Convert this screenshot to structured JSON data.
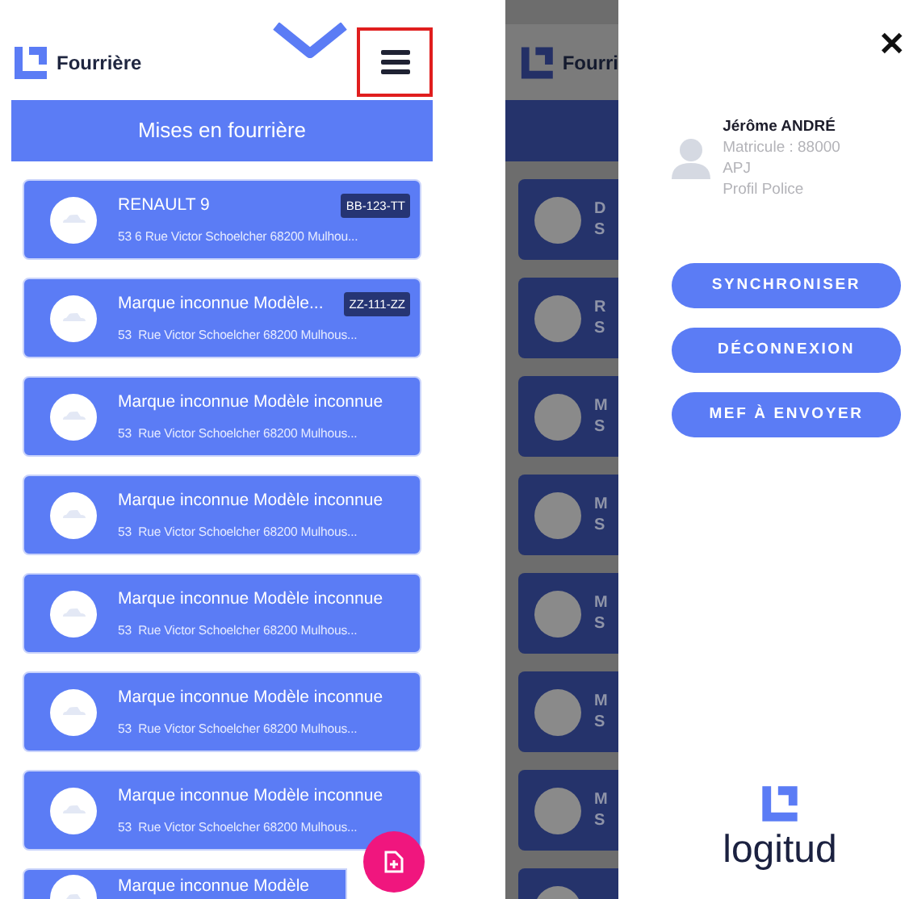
{
  "left_screen": {
    "app_name": "Fourrière",
    "menu_highlighted": true,
    "title": "Mises en fourrière",
    "vehicles": [
      {
        "title": "RENAULT 9",
        "plate": "BB-123-TT",
        "address": "53 6 Rue Victor Schoelcher 68200 Mulhou..."
      },
      {
        "title": "Marque inconnue Modèle...",
        "plate": "ZZ-111-ZZ",
        "address": "53  Rue Victor Schoelcher 68200 Mulhous..."
      },
      {
        "title": "Marque inconnue Modèle inconnue",
        "address": "53  Rue Victor Schoelcher 68200 Mulhous..."
      },
      {
        "title": "Marque inconnue Modèle inconnue",
        "address": "53  Rue Victor Schoelcher 68200 Mulhous..."
      },
      {
        "title": "Marque inconnue Modèle inconnue",
        "address": "53  Rue Victor Schoelcher 68200 Mulhous..."
      },
      {
        "title": "Marque inconnue Modèle inconnue",
        "address": "53  Rue Victor Schoelcher 68200 Mulhous..."
      },
      {
        "title": "Marque inconnue Modèle inconnue",
        "address": "53  Rue Victor Schoelcher 68200 Mulhous..."
      },
      {
        "title": "Marque inconnue Modèle"
      }
    ]
  },
  "right_screen": {
    "background": {
      "app_name": "Fourri",
      "cards": [
        {
          "kind": "text",
          "title": "D",
          "address": "S"
        },
        {
          "kind": "text",
          "title": "R",
          "address": "S"
        },
        {
          "kind": "text",
          "title": "M",
          "address": "S"
        },
        {
          "kind": "text",
          "title": "M",
          "address": "S"
        },
        {
          "kind": "text",
          "title": "M",
          "address": "S"
        },
        {
          "kind": "text",
          "title": "M",
          "address": "S"
        },
        {
          "kind": "text",
          "title": "M",
          "address": "S"
        },
        {
          "kind": "blank"
        }
      ]
    },
    "drawer": {
      "close": "✕",
      "user": {
        "name": "Jérôme ANDRÉ",
        "lines": [
          "Matricule : 88000",
          "APJ",
          "Profil Police"
        ]
      },
      "buttons": [
        "SYNCHRONISER",
        "DÉCONNEXION",
        "MEF À ENVOYER"
      ],
      "brand": "logitud"
    }
  }
}
